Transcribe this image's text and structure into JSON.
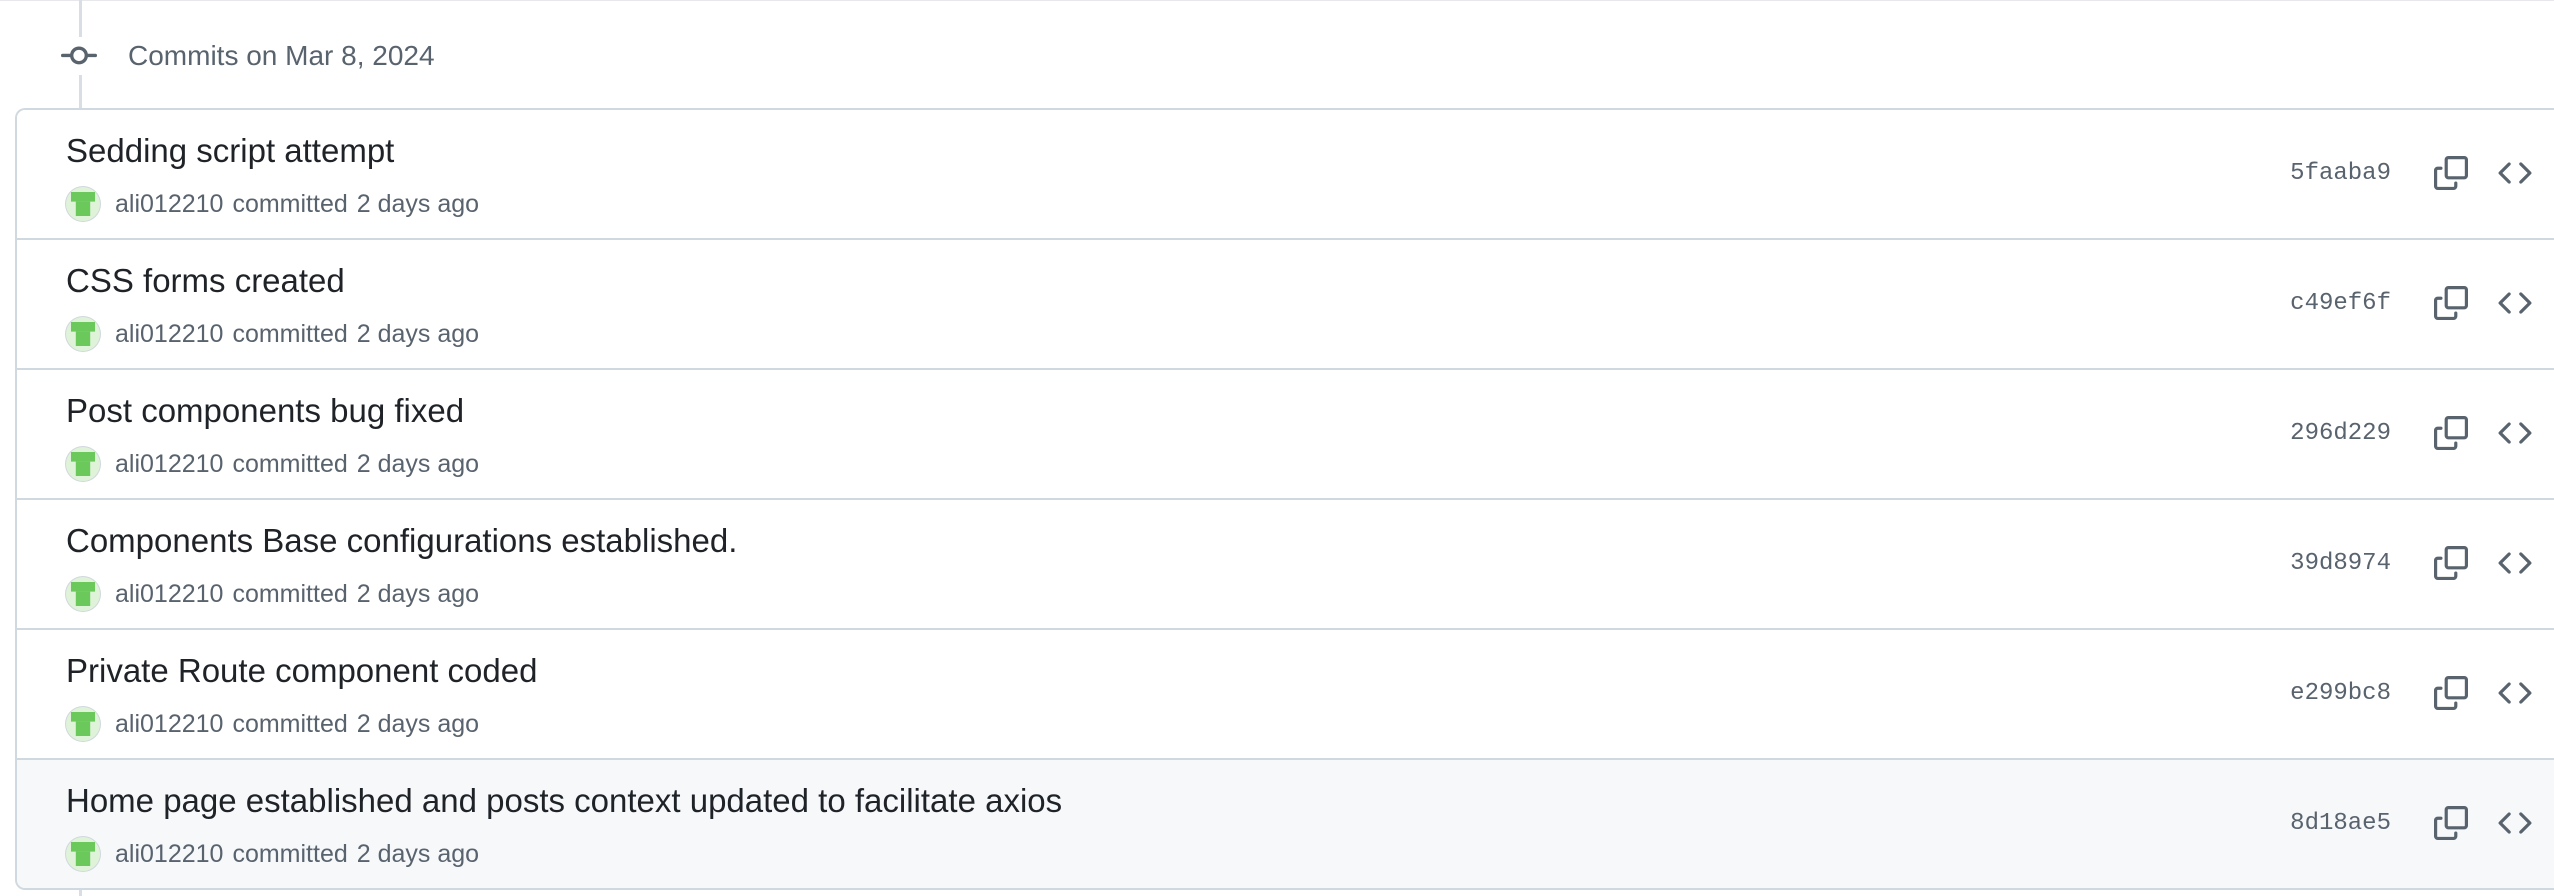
{
  "group": {
    "title": "Commits on Mar 8, 2024"
  },
  "commits": [
    {
      "title": "Sedding script attempt",
      "author": "ali012210",
      "action": "committed",
      "time": "2 days ago",
      "sha": "5faaba9"
    },
    {
      "title": "CSS forms created",
      "author": "ali012210",
      "action": "committed",
      "time": "2 days ago",
      "sha": "c49ef6f"
    },
    {
      "title": "Post components bug fixed",
      "author": "ali012210",
      "action": "committed",
      "time": "2 days ago",
      "sha": "296d229"
    },
    {
      "title": "Components Base configurations established.",
      "author": "ali012210",
      "action": "committed",
      "time": "2 days ago",
      "sha": "39d8974"
    },
    {
      "title": "Private Route component coded",
      "author": "ali012210",
      "action": "committed",
      "time": "2 days ago",
      "sha": "e299bc8"
    },
    {
      "title": "Home page established and posts context updated to facilitate axios",
      "author": "ali012210",
      "action": "committed",
      "time": "2 days ago",
      "sha": "8d18ae5"
    }
  ],
  "icons": {
    "group_node": "git-commit-icon",
    "copy": "copy-icon",
    "browse": "code-icon",
    "avatar": "identicon-avatar"
  },
  "colors": {
    "avatar_fill": "#6bc85a",
    "avatar_bg": "#dff3d9",
    "muted_text": "#59636e",
    "border": "#d1d9e0",
    "hover_row_bg": "#f6f8fa"
  }
}
